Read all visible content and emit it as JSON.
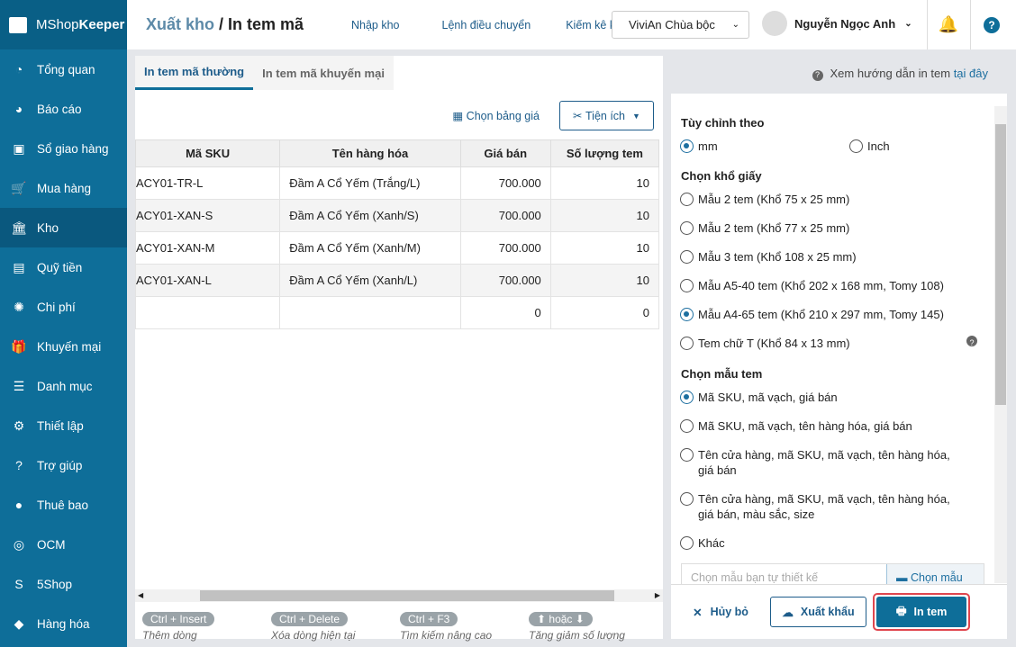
{
  "app": {
    "brand_light": "MShop",
    "brand_bold": "Keeper"
  },
  "sidebar": {
    "items": [
      {
        "label": "Tổng quan",
        "icon": "◔"
      },
      {
        "label": "Báo cáo",
        "icon": "◕"
      },
      {
        "label": "Sổ giao hàng",
        "icon": "▣"
      },
      {
        "label": "Mua hàng",
        "icon": "🛒"
      },
      {
        "label": "Kho",
        "icon": "🏛"
      },
      {
        "label": "Quỹ tiền",
        "icon": "▤"
      },
      {
        "label": "Chi phí",
        "icon": "✺"
      },
      {
        "label": "Khuyến mại",
        "icon": "🎁"
      },
      {
        "label": "Danh mục",
        "icon": "☰"
      },
      {
        "label": "Thiết lập",
        "icon": "⚙"
      },
      {
        "label": "Trợ giúp",
        "icon": "?"
      },
      {
        "label": "Thuê bao",
        "icon": "●"
      },
      {
        "label": "OCM",
        "icon": "◎"
      },
      {
        "label": "5Shop",
        "icon": "S"
      },
      {
        "label": "Hàng hóa",
        "icon": "◆"
      }
    ]
  },
  "header": {
    "breadcrumb_parent": "Xuất kho",
    "breadcrumb_sep": " / ",
    "title": "In tem mã",
    "nav": [
      "Nhập kho",
      "Lệnh điều chuyển",
      "Kiếm kê kh"
    ],
    "store": "ViviAn Chùa bộc",
    "user": "Nguyễn Ngọc Anh"
  },
  "tabs": [
    "In tem mã thường",
    "In tem mã khuyến mại"
  ],
  "help": {
    "text": "Xem hướng dẫn in tem ",
    "link": "tại đây"
  },
  "toolbar": {
    "price_table": "Chọn bảng giá",
    "utilities": "Tiện ích"
  },
  "table": {
    "columns": [
      "Mã SKU",
      "Tên hàng hóa",
      "Giá bán",
      "Số lượng tem"
    ],
    "rows": [
      [
        "ACY01-TR-L",
        "Đầm A Cổ Yếm (Trắng/L)",
        "700.000",
        "10"
      ],
      [
        "ACY01-XAN-S",
        "Đầm A Cổ Yếm (Xanh/S)",
        "700.000",
        "10"
      ],
      [
        "ACY01-XAN-M",
        "Đầm A Cổ Yếm (Xanh/M)",
        "700.000",
        "10"
      ],
      [
        "ACY01-XAN-L",
        "Đầm A Cổ Yếm (Xanh/L)",
        "700.000",
        "10"
      ],
      [
        "",
        "",
        "0",
        "0"
      ]
    ]
  },
  "shortcuts": [
    {
      "key": "Ctrl + Insert",
      "desc": "Thêm dòng"
    },
    {
      "key": "Ctrl + Delete",
      "desc": "Xóa dòng hiện tại"
    },
    {
      "key": "Ctrl + F3",
      "desc": "Tìm kiếm nâng cao"
    },
    {
      "key": "⬆ hoặc ⬇",
      "desc": "Tăng giảm số lượng"
    }
  ],
  "settings": {
    "unit_title": "Tùy chỉnh theo",
    "unit_mm": "mm",
    "unit_inch": "Inch",
    "paper_title": "Chọn khổ giấy",
    "papers": [
      "Mẫu 2 tem (Khổ 75 x 25 mm)",
      "Mẫu 2 tem (Khổ 77 x 25 mm)",
      "Mẫu 3 tem (Khổ 108 x 25 mm)",
      "Mẫu A5-40 tem (Khổ 202 x 168 mm, Tomy 108)",
      "Mẫu A4-65 tem (Khổ 210 x 297 mm, Tomy 145)",
      "Tem chữ T (Khổ 84 x 13 mm)"
    ],
    "template_title": "Chọn mẫu tem",
    "templates": [
      "Mã SKU, mã vạch, giá bán",
      "Mã SKU, mã vạch, tên hàng hóa, giá bán",
      "Tên cửa hàng, mã SKU, mã vạch, tên hàng hóa, giá bán",
      "Tên cửa hàng, mã SKU, mã vạch, tên hàng hóa, giá bán, màu sắc, size",
      "Khác"
    ],
    "custom_placeholder": "Chọn mẫu bạn tự thiết kế",
    "choose_template": "Chọn mẫu"
  },
  "footer": {
    "cancel": "Hủy bỏ",
    "export": "Xuất khẩu",
    "print": "In tem"
  }
}
